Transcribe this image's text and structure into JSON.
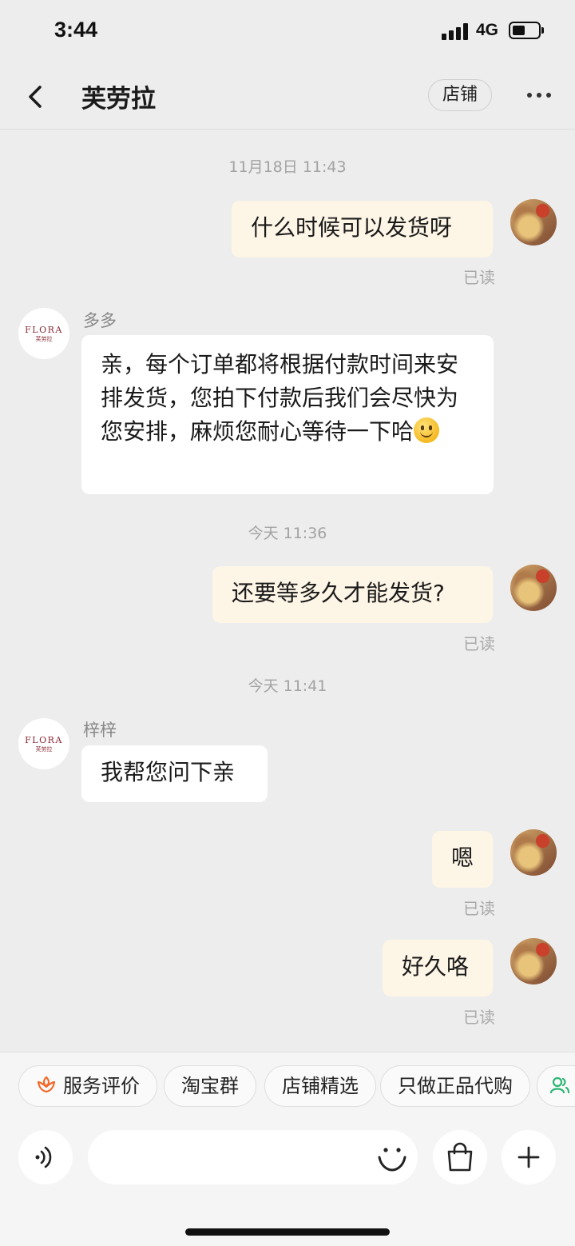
{
  "status_bar": {
    "time": "3:44",
    "network": "4G"
  },
  "header": {
    "title": "芙劳拉",
    "shop_button": "店铺"
  },
  "shop_logo": {
    "text": "FLORA",
    "sub": "芙劳拉"
  },
  "messages": [
    {
      "type": "time",
      "text": "11月18日 11:43"
    },
    {
      "type": "mine",
      "text": "什么时候可以发货呀",
      "status": "已读"
    },
    {
      "type": "theirs",
      "sender": "多多",
      "text": "亲，每个订单都将根据付款时间来安排发货，您拍下付款后我们会尽快为您安排，麻烦您耐心等待一下哈",
      "emoji": "smile-emoji"
    },
    {
      "type": "time",
      "text": "今天 11:36"
    },
    {
      "type": "mine",
      "text": "还要等多久才能发货?",
      "status": "已读"
    },
    {
      "type": "time",
      "text": "今天 11:41"
    },
    {
      "type": "theirs",
      "sender": "梓梓",
      "text": "我帮您问下亲"
    },
    {
      "type": "mine",
      "text": "嗯",
      "status": "已读"
    },
    {
      "type": "mine",
      "text": "好久咯",
      "status": "已读"
    }
  ],
  "quick_actions": [
    {
      "label": "服务评价",
      "icon": "flower-icon"
    },
    {
      "label": "淘宝群"
    },
    {
      "label": "店铺精选"
    },
    {
      "label": "只做正品代购"
    }
  ],
  "input_bar": {
    "placeholder": ""
  },
  "colors": {
    "background": "#ededed",
    "my_bubble": "#fdf5e6",
    "their_bubble": "#ffffff",
    "accent_orange": "#f06a2a",
    "accent_green": "#2bb673"
  }
}
